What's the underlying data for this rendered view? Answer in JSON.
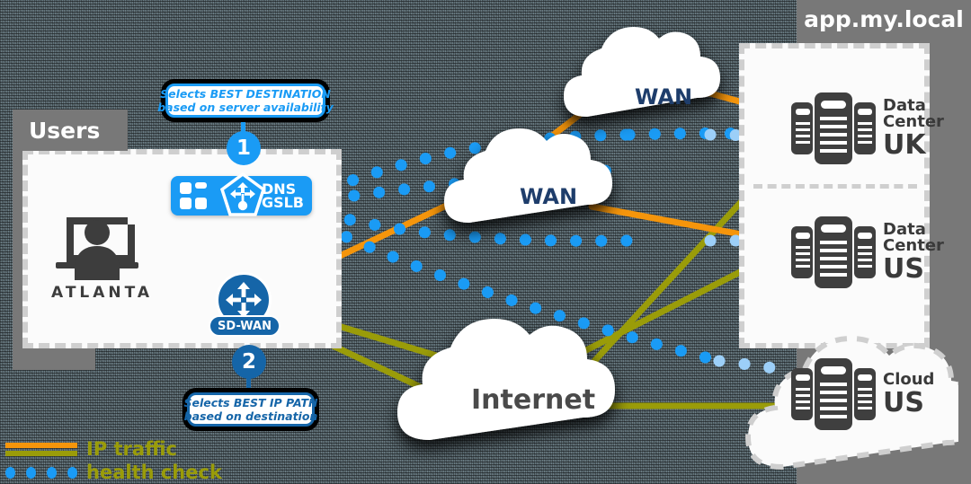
{
  "background": {
    "color": "#6d7f87",
    "texture": "dithered-noise"
  },
  "colors": {
    "ip_traffic_orange": "#f5950b",
    "ip_traffic_olive": "#9a9c09",
    "health_check_blue": "#1a9bf5",
    "brand_blue_dark": "#1565a8",
    "panel_gray": "#787878",
    "panel_white": "#fbfbfb",
    "dashed_border": "#cfcfcf",
    "device_dark": "#3f3f3f"
  },
  "users": {
    "header_label": "Users",
    "site_label": "ATLANTA",
    "user_icon": "user-at-monitor-icon"
  },
  "gslb": {
    "icon_left": "app-grid-icon",
    "icon_center": "gslb-pentagon-icon",
    "line1": "DNS",
    "line2": "GSLB"
  },
  "sdwan": {
    "label": "SD-WAN",
    "icon": "four-arrows-router-icon"
  },
  "callouts": [
    {
      "number": "1",
      "line1": "Selects BEST DESTINATION",
      "line2": "based on server availability",
      "accent": "#1a9bf5"
    },
    {
      "number": "2",
      "line1": "Selects BEST IP PATH",
      "line2": "based on destination",
      "accent": "#1565a8"
    }
  ],
  "clouds": [
    {
      "id": "wan-top",
      "label": "WAN",
      "style": "solid",
      "text_color": "#1e3d6b"
    },
    {
      "id": "wan-mid",
      "label": "WAN",
      "style": "solid",
      "text_color": "#1e3d6b"
    },
    {
      "id": "internet",
      "label": "Internet",
      "style": "solid",
      "text_color": "#4a4a4a"
    }
  ],
  "destinations": {
    "header_label": "app.my.local",
    "sites": [
      {
        "kind": "Data",
        "kind2": "Center",
        "code": "UK",
        "icon": "server-rack-icon",
        "container": "dashed-box"
      },
      {
        "kind": "Data",
        "kind2": "Center",
        "code": "US",
        "icon": "server-rack-icon",
        "container": "dashed-box"
      },
      {
        "kind": "Cloud",
        "kind2": "",
        "code": "US",
        "icon": "server-rack-icon",
        "container": "dashed-cloud"
      }
    ]
  },
  "legend": {
    "items": [
      {
        "label": "IP traffic",
        "marker": "two-line-swatch"
      },
      {
        "label": "health check",
        "marker": "blue-dots"
      }
    ]
  }
}
